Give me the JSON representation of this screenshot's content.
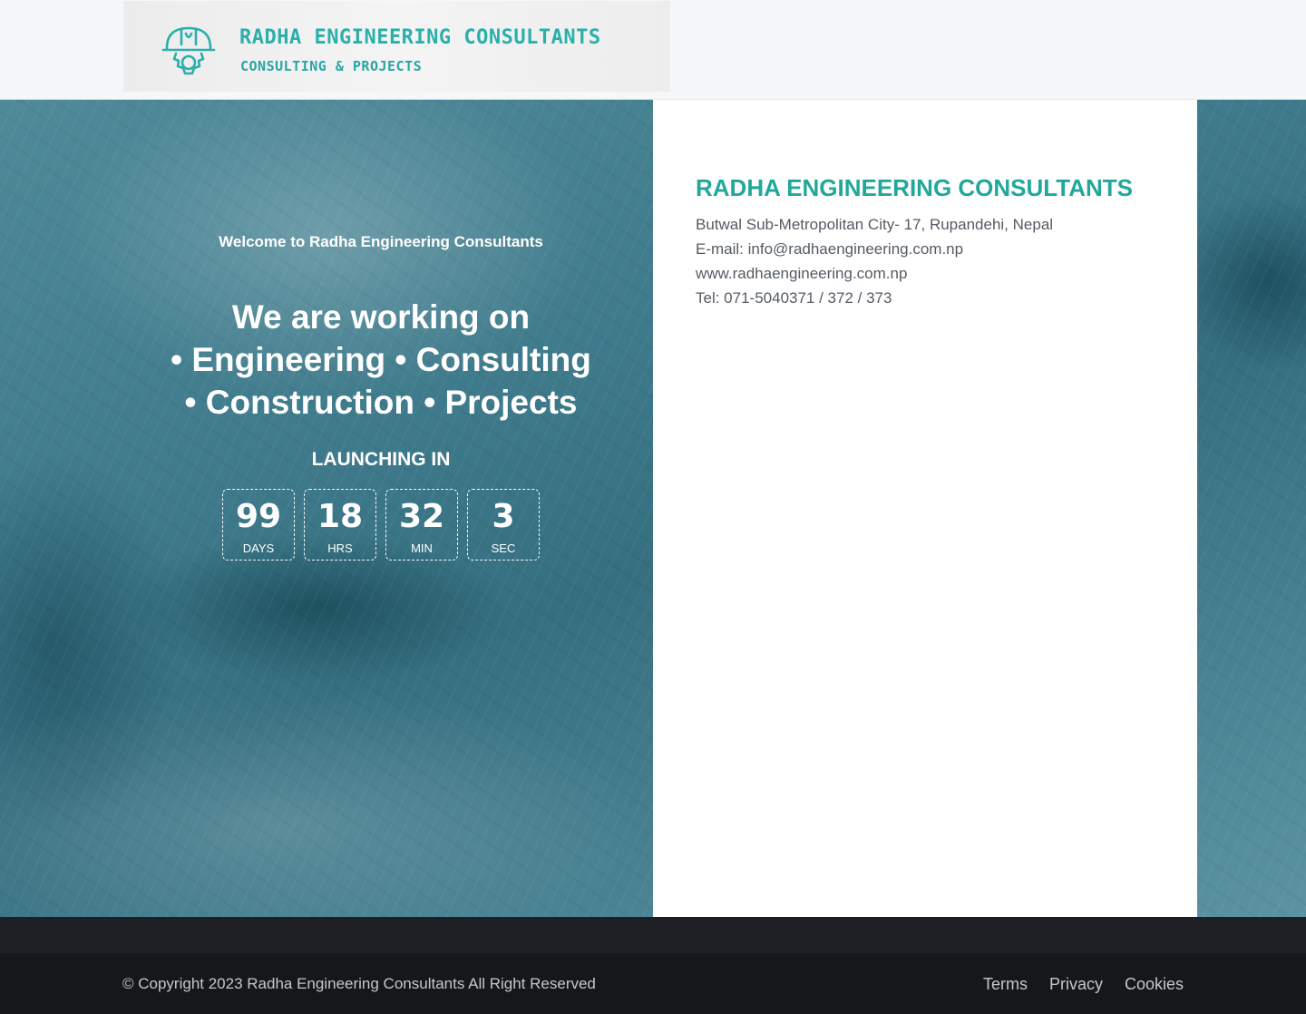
{
  "header": {
    "logo_title": "RADHA ENGINEERING CONSULTANTS",
    "logo_subtitle": "CONSULTING & PROJECTS",
    "logo_icon": "engineer-helmet-gear-icon",
    "brand_color": "#2ab0ab"
  },
  "hero": {
    "welcome": "Welcome to Radha Engineering Consultants",
    "headline_lines": [
      "We are working on",
      "• Engineering • Consulting",
      "• Construction • Projects"
    ],
    "launching_label": "LAUNCHING IN",
    "countdown": [
      {
        "value": "99",
        "label": "DAYS"
      },
      {
        "value": "18",
        "label": "HRS"
      },
      {
        "value": "32",
        "label": "MIN"
      },
      {
        "value": "3",
        "label": "SEC"
      }
    ]
  },
  "contact": {
    "company": "RADHA ENGINEERING CONSULTANTS",
    "address": "Butwal Sub-Metropolitan City- 17, Rupandehi, Nepal",
    "email": "E-mail: info@radhaengineering.com.np",
    "website": "www.radhaengineering.com.np",
    "tel": "Tel: 071-5040371 / 372 / 373",
    "accent_color": "#22a89a"
  },
  "footer": {
    "copyright": "© Copyright 2023 Radha Engineering Consultants All Right Reserved",
    "links": [
      "Terms",
      "Privacy",
      "Cookies"
    ]
  }
}
